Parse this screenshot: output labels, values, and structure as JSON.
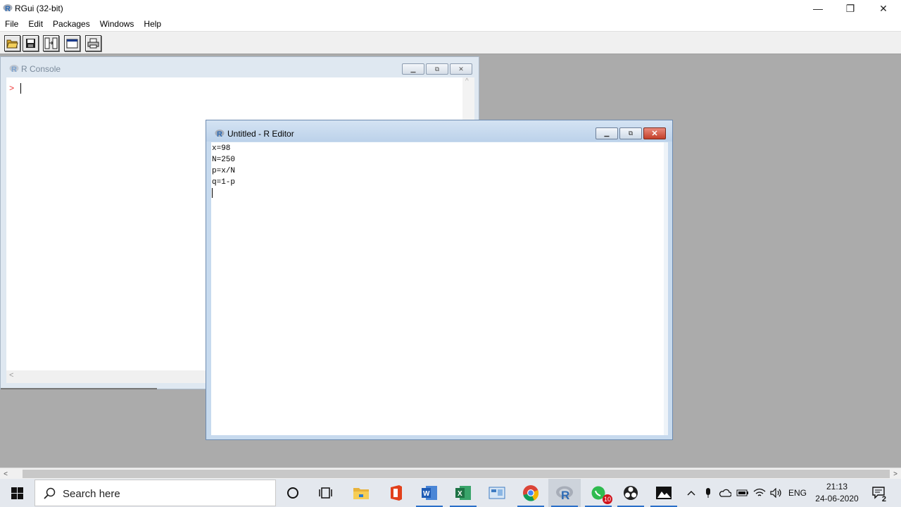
{
  "app": {
    "title": "RGui (32-bit)",
    "logo_letter": "R"
  },
  "window_controls": {
    "minimize": "—",
    "restore": "❐",
    "close": "✕"
  },
  "menu": [
    {
      "label": "File"
    },
    {
      "label": "Edit"
    },
    {
      "label": "Packages"
    },
    {
      "label": "Windows"
    },
    {
      "label": "Help"
    }
  ],
  "toolbar": {
    "buttons": [
      {
        "icon": "open-script-icon"
      },
      {
        "icon": "save-icon"
      },
      {
        "icon": "copy-paste-icon"
      },
      {
        "icon": "console-window-icon"
      },
      {
        "icon": "print-icon"
      }
    ]
  },
  "console": {
    "title": "R Console",
    "prompt": ">"
  },
  "editor": {
    "title": "Untitled - R Editor",
    "lines": [
      "x=98",
      "N=250",
      "p=x/N",
      "q=1-p"
    ]
  },
  "child_controls": {
    "minimize": "▁",
    "restore": "⧉",
    "close": "✕"
  },
  "scrollbar": {
    "left_arrow": "<",
    "right_arrow": ">",
    "up_arrow": "^"
  },
  "taskbar": {
    "search_placeholder": "Search here",
    "apps": [
      {
        "icon": "cortana-icon"
      },
      {
        "icon": "task-view-icon"
      },
      {
        "icon": "file-explorer-icon"
      },
      {
        "icon": "office-icon"
      },
      {
        "icon": "word-icon"
      },
      {
        "icon": "excel-icon"
      },
      {
        "icon": "control-panel-icon"
      },
      {
        "icon": "chrome-icon"
      },
      {
        "icon": "r-gui-icon"
      },
      {
        "icon": "whatsapp-icon",
        "badge": "10"
      },
      {
        "icon": "obs-icon"
      },
      {
        "icon": "photos-icon"
      }
    ],
    "language": "ENG",
    "time": "21:13",
    "date": "24-06-2020",
    "notifications": "2"
  },
  "colors": {
    "workspace": "#ababab",
    "editor_frame": "#c7daee",
    "console_frame": "#dfe8f1",
    "r_blue": "#2d6bb5",
    "prompt_red": "#e33333",
    "close_red": "#c3402a"
  }
}
